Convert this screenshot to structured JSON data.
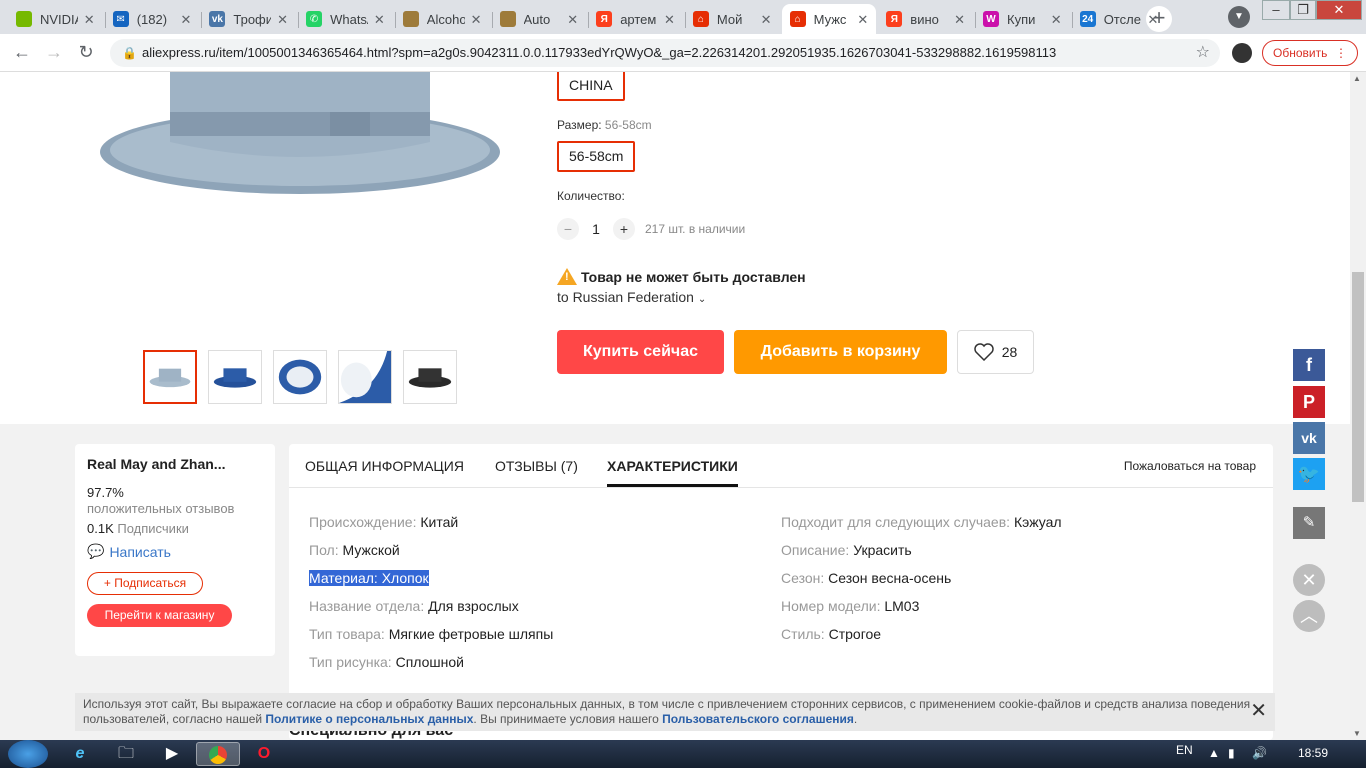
{
  "browser": {
    "tabs": [
      {
        "title": "NVIDIA",
        "icon": "nvidia-icon",
        "color": "#76b900",
        "glyph": ""
      },
      {
        "title": "(182)",
        "icon": "mail-icon",
        "color": "#1565c0",
        "glyph": "✉"
      },
      {
        "title": "Трофи",
        "icon": "vk-icon",
        "color": "#4a76a8",
        "glyph": "vk"
      },
      {
        "title": "WhatsApp",
        "icon": "whatsapp-icon",
        "color": "#25d366",
        "glyph": "✆"
      },
      {
        "title": "Alcohol",
        "icon": "chrome-icon",
        "color": "#9e7b3a",
        "glyph": ""
      },
      {
        "title": "Auto",
        "icon": "chrome-icon",
        "color": "#9e7b3a",
        "glyph": ""
      },
      {
        "title": "артем",
        "icon": "yandex-icon",
        "color": "#fc3f1d",
        "glyph": "Я"
      },
      {
        "title": "Мой",
        "icon": "aliexpress-icon",
        "color": "#e62e04",
        "glyph": "⌂"
      },
      {
        "title": "Мужс",
        "icon": "aliexpress-icon",
        "color": "#e62e04",
        "glyph": "⌂"
      },
      {
        "title": "вино",
        "icon": "yandex-icon",
        "color": "#fc3f1d",
        "glyph": "Я"
      },
      {
        "title": "Купи",
        "icon": "wildberries-icon",
        "color": "#cb11ab",
        "glyph": "W"
      },
      {
        "title": "Отсле",
        "icon": "tracking-icon",
        "color": "#1976d2",
        "glyph": "24"
      }
    ],
    "active_tab": 8,
    "url": "aliexpress.ru/item/1005001346365464.html?spm=a2g0s.9042311.0.0.117933edYrQWyO&_ga=2.226314201.292051935.1626703041-533298882.1619598113",
    "update_label": "Обновить"
  },
  "product": {
    "ship_from": "CHINA",
    "size_label": "Размер:",
    "size_value": "56-58cm",
    "size_option": "56-58cm",
    "qty_label": "Количество:",
    "qty_value": "1",
    "stock": "217 шт. в наличии",
    "warning": "Товар не может быть доставлен",
    "country": "to Russian Federation",
    "buy_now": "Купить сейчас",
    "add_to_cart": "Добавить в корзину",
    "wish_count": "28"
  },
  "store": {
    "name": "Real May and Zhan...",
    "positive_pct": "97.7%",
    "positive_label": "положительных отзывов",
    "followers_count": "0.1K",
    "followers_label": "Подписчики",
    "write": "Написать",
    "subscribe": "+ Подписаться",
    "go_to_store": "Перейти к магазину"
  },
  "tabs": {
    "general": "ОБЩАЯ ИНФОРМАЦИЯ",
    "reviews": "ОТЗЫВЫ (7)",
    "specs": "ХАРАКТЕРИСТИКИ",
    "report": "Пожаловаться на товар"
  },
  "specs_left": [
    {
      "k": "Происхождение:",
      "v": "Китай"
    },
    {
      "k": "Пол:",
      "v": "Мужской"
    },
    {
      "k": "Материал:",
      "v": "Хлопок"
    },
    {
      "k": "Название отдела:",
      "v": "Для взрослых"
    },
    {
      "k": "Тип товара:",
      "v": "Мягкие фетровые шляпы"
    },
    {
      "k": "Тип рисунка:",
      "v": "Сплошной"
    }
  ],
  "specs_right": [
    {
      "k": "Подходит для следующих случаев:",
      "v": "Кэжуал"
    },
    {
      "k": "Описание:",
      "v": "Украсить"
    },
    {
      "k": "Сезон:",
      "v": "Сезон весна-осень"
    },
    {
      "k": "Номер модели:",
      "v": "LM03"
    },
    {
      "k": "Стиль:",
      "v": "Строгое"
    }
  ],
  "cookie": {
    "text1": "Используя этот сайт, Вы выражаете согласие на сбор и обработку Ваших персональных данных, в том числе с привлечением сторонних сервисов, с применением cookie-файлов и средств анализа поведения пользователей, согласно нашей ",
    "link1": "Политике о персональных данных",
    "text2": ". Вы принимаете условия нашего ",
    "link2": "Пользовательского соглашения",
    "text3": "."
  },
  "peek_heading": "Специально для вас",
  "taskbar": {
    "lang": "EN",
    "time": "18:59"
  },
  "colors": {
    "accent": "#e62e04",
    "buy": "#ff4747",
    "cart": "#ff9900",
    "link": "#3a77c8"
  }
}
